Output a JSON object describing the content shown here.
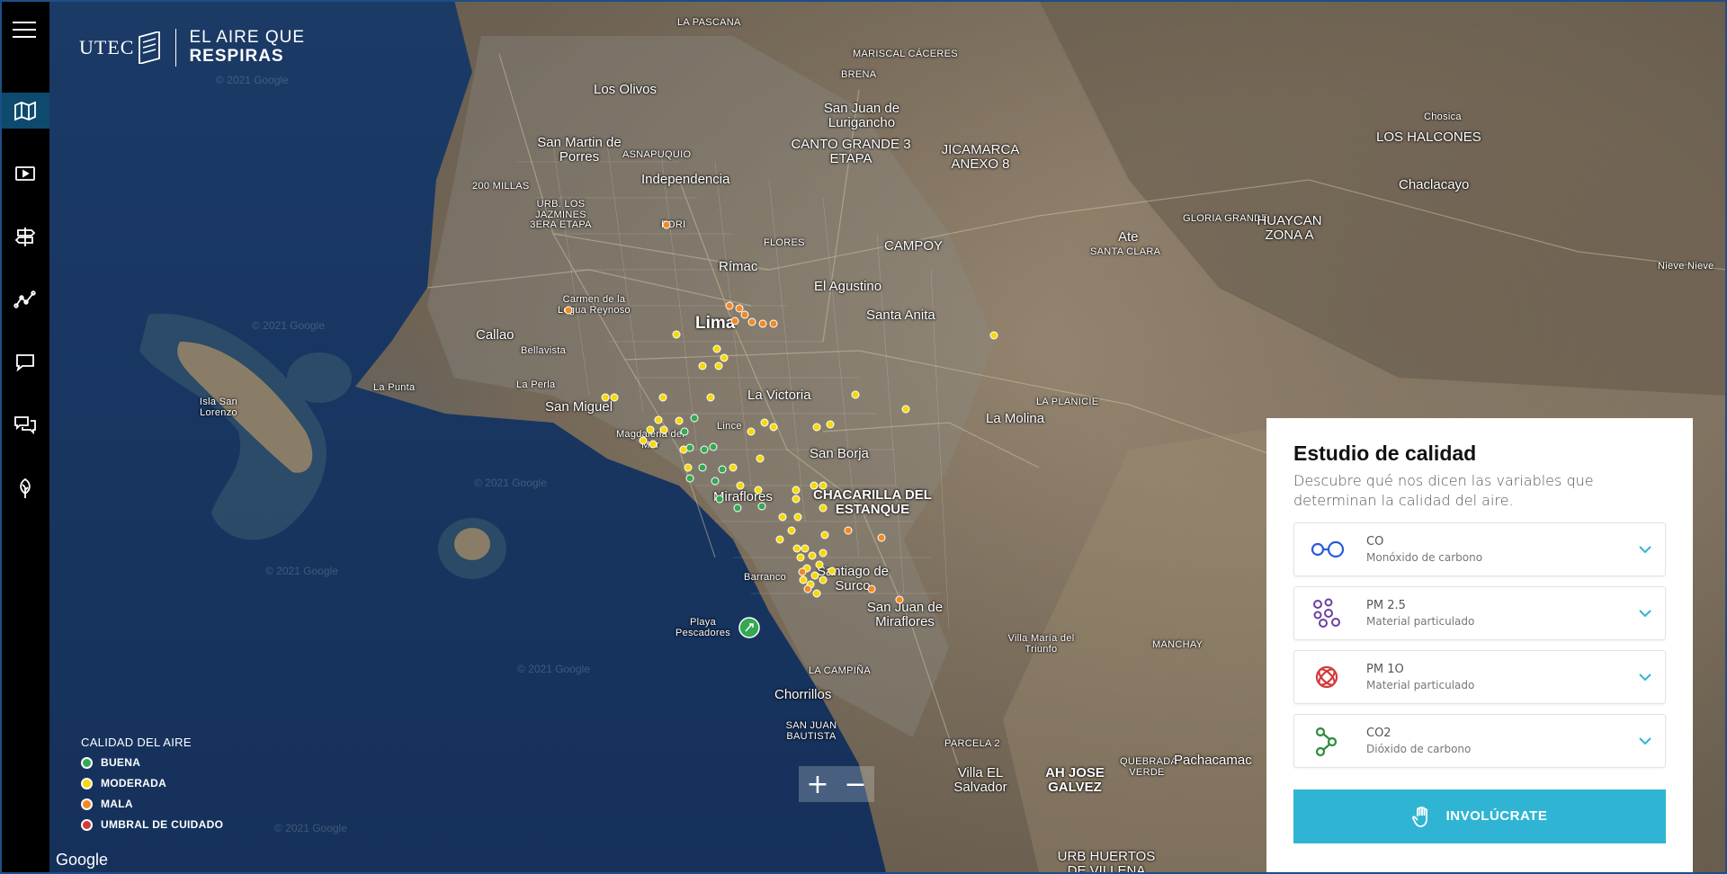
{
  "app": {
    "brand": "UTEC",
    "title_line1": "EL AIRE QUE",
    "title_line2": "RESPIRAS"
  },
  "sidebar": {
    "items": [
      {
        "icon": "map-icon"
      },
      {
        "icon": "video-icon"
      },
      {
        "icon": "signpost-icon"
      },
      {
        "icon": "line-graph-icon"
      },
      {
        "icon": "chat-icon"
      },
      {
        "icon": "conversation-icon"
      },
      {
        "icon": "leaf-icon"
      }
    ]
  },
  "map": {
    "watermark": "© 2021 Google",
    "google": "Google",
    "labels": [
      "LA PASCANA",
      "Los Olivos",
      "MARISCAL CÁCERES",
      "BRENA",
      "San Juan de Lurigancho",
      "San Martin de Porres",
      "ASNAPUQUIO",
      "CANTO GRANDE 3 ETAPA",
      "JICAMARCA ANEXO 8",
      "Chosica",
      "LOS HALCONES",
      "Independencia",
      "200 MILLAS",
      "URB. LOS JAZMINES 3ERA ETAPA",
      "Chaclacayo",
      "GLORIA GRANDE",
      "HUAYCAN ZONA A",
      "Ate",
      "SANTA CLARA",
      "FLORES",
      "CAMPOY",
      "Nieve Nieve",
      "Rímac",
      "El Agustino",
      "Carmen de la Legua Reynoso",
      "Santa Anita",
      "Lima",
      "Callao",
      "Bellavista",
      "La Punta",
      "La Perla",
      "LA PLANICIE",
      "San Miguel",
      "La Victoria",
      "La Molina",
      "Isla San Lorenzo",
      "Lince",
      "Magdalena del Mar",
      "San Borja",
      "Miraflores",
      "CHACARILLA DEL ESTANQUE",
      "Barranco",
      "Santiago de Surco",
      "San Juan de Miraflores",
      "Playa Pescadores",
      "Villa María del Triunfo",
      "MANCHAY",
      "LA CAMPIÑA",
      "Chorrillos",
      "SAN JUAN BAUTISTA",
      "PARCELA 2",
      "Villa EL Salvador",
      "AH JOSE GALVEZ",
      "QUEBRADA VERDE",
      "Pachacamac",
      "URB HUERTOS DE VILLENA",
      "FORI"
    ]
  },
  "legend": {
    "title": "CALIDAD DEL AIRE",
    "items": [
      {
        "label": "BUENA",
        "color": "#34a853"
      },
      {
        "label": "MODERADA",
        "color": "#f5d90a"
      },
      {
        "label": "MALA",
        "color": "#f08a24"
      },
      {
        "label": "UMBRAL DE CUIDADO",
        "color": "#d23b3b"
      }
    ]
  },
  "zoom": {
    "in": "+",
    "out": "−"
  },
  "panel": {
    "title": "Estudio de calidad",
    "description": "Descubre qué nos dicen las variables que determinan la calidad del aire.",
    "variables": [
      {
        "name": "CO",
        "sub": "Monóxido de carbono",
        "color": "#2a5bd7",
        "icon": "co-molecule-icon"
      },
      {
        "name": "PM 2.5",
        "sub": "Material particulado",
        "color": "#6b3fa0",
        "icon": "pm25-particles-icon"
      },
      {
        "name": "PM 1O",
        "sub": "Material particulado",
        "color": "#d23b3b",
        "icon": "pm10-particles-icon"
      },
      {
        "name": "CO2",
        "sub": "Dióxido de carbono",
        "color": "#2e8b3a",
        "icon": "co2-molecule-icon"
      }
    ],
    "chevron_color": "#2fb5d3",
    "cta": "INVOLÚCRATE"
  }
}
